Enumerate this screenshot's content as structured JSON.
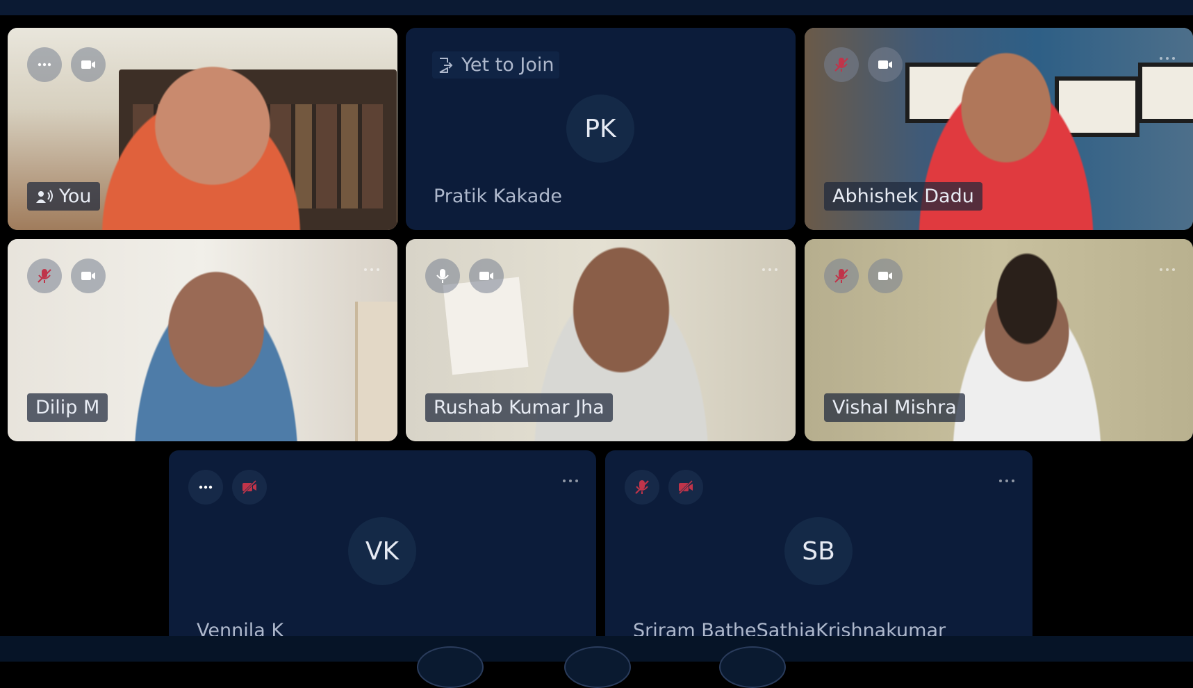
{
  "colors": {
    "background": "#000000",
    "tile_dark": "#0c1c3a",
    "muted_red": "#c0344a",
    "text_light": "#e8ecf4"
  },
  "tiles": [
    {
      "name": "You",
      "initials": "",
      "video": true,
      "mic": "options",
      "camera": "on",
      "speaking_icon": "speaker-icon"
    },
    {
      "name": "Pratik Kakade",
      "initials": "PK",
      "video": false,
      "status": "Yet to Join"
    },
    {
      "name": "Abhishek Dadu",
      "initials": "",
      "video": true,
      "mic": "muted",
      "camera": "on"
    },
    {
      "name": "Dilip M",
      "initials": "",
      "video": true,
      "mic": "muted",
      "camera": "on"
    },
    {
      "name": "Rushab Kumar Jha",
      "initials": "",
      "video": true,
      "mic": "on",
      "camera": "on"
    },
    {
      "name": "Vishal Mishra",
      "initials": "",
      "video": true,
      "mic": "muted",
      "camera": "on"
    },
    {
      "name": "Vennila K",
      "initials": "VK",
      "video": false,
      "mic": "options",
      "camera": "off"
    },
    {
      "name": "Sriram BatheSathiaKrishnakumar",
      "initials": "SB",
      "video": false,
      "mic": "muted",
      "camera": "off"
    }
  ]
}
